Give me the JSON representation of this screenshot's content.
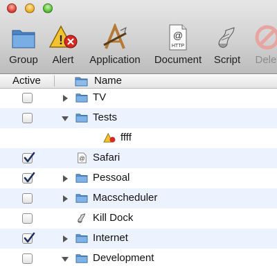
{
  "toolbar": {
    "group": "Group",
    "alert": "Alert",
    "application": "Application",
    "document": "Document",
    "script": "Script",
    "delete": "Delet",
    "doc_icon_text": "HTTP"
  },
  "columns": {
    "active": "Active",
    "name": "Name"
  },
  "rows": [
    {
      "label": "TV",
      "checked": false,
      "disclosure": "collapsed",
      "icon": "folder-icon"
    },
    {
      "label": "Tests",
      "checked": false,
      "disclosure": "expanded",
      "icon": "folder-icon"
    },
    {
      "label": "ffff",
      "checked": null,
      "disclosure": "none",
      "icon": "alert-icon"
    },
    {
      "label": "Safari",
      "checked": true,
      "disclosure": "none",
      "icon": "document-icon"
    },
    {
      "label": "Pessoal",
      "checked": true,
      "disclosure": "collapsed",
      "icon": "folder-icon"
    },
    {
      "label": "Macscheduler",
      "checked": false,
      "disclosure": "collapsed",
      "icon": "folder-icon"
    },
    {
      "label": "Kill Dock",
      "checked": false,
      "disclosure": "none",
      "icon": "script-icon"
    },
    {
      "label": "Internet",
      "checked": true,
      "disclosure": "collapsed",
      "icon": "folder-icon"
    },
    {
      "label": "Development",
      "checked": false,
      "disclosure": "expanded",
      "icon": "folder-icon"
    }
  ],
  "colors": {
    "row_stripe": "#edf3fe",
    "folder_blue": "#7fb2e6",
    "checkmark": "#1f2f5e"
  }
}
